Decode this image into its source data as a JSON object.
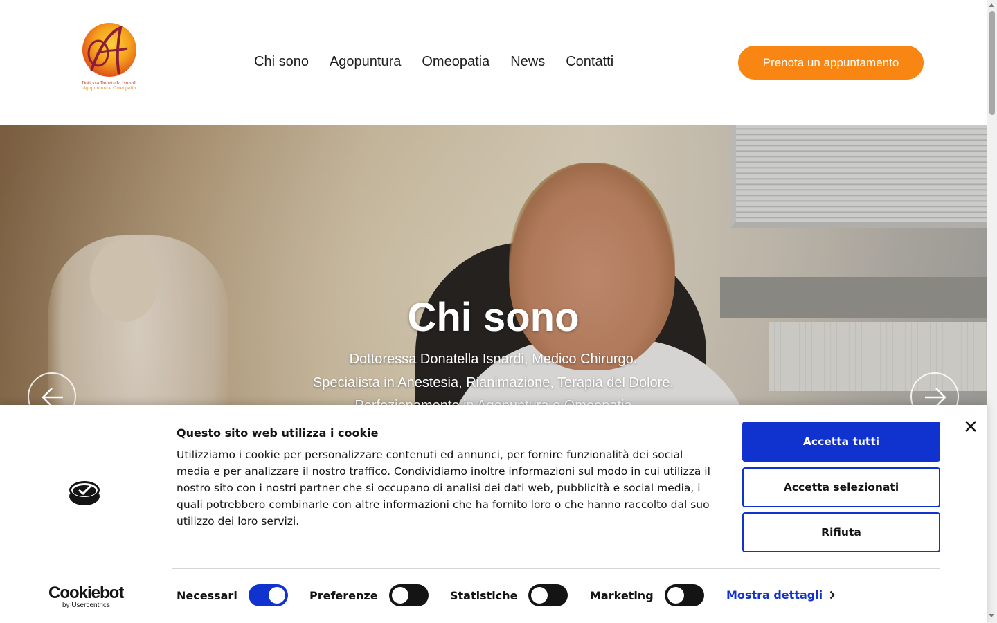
{
  "header": {
    "logo_caption_line1": "Dott.ssa Donatella Isnardi",
    "logo_caption_line2": "Agopuntura e Omeopatia",
    "nav": [
      "Chi sono",
      "Agopuntura",
      "Omeopatia",
      "News",
      "Contatti"
    ],
    "cta_label": "Prenota un appuntamento"
  },
  "hero": {
    "title": "Chi sono",
    "lines": [
      "Dottoressa Donatella Isnardi, Medico Chirurgo.",
      "Specialista in Anestesia, Rianimazione, Terapia del Dolore.",
      "Perfezionamento in Agopuntura e Omeopatia"
    ]
  },
  "cookie": {
    "title": "Questo sito web utilizza i cookie",
    "text": "Utilizziamo i cookie per personalizzare contenuti ed annunci, per fornire funzionalità dei social media e per analizzare il nostro traffico. Condividiamo inoltre informazioni sul modo in cui utilizza il nostro sito con i nostri partner che si occupano di analisi dei dati web, pubblicità e social media, i quali potrebbero combinarle con altre informazioni che ha fornito loro o che hanno raccolto dal suo utilizzo dei loro servizi.",
    "buttons": {
      "accept_all": "Accetta tutti",
      "accept_selected": "Accetta selezionati",
      "reject": "Rifiuta"
    },
    "brand_name": "Cookiebot",
    "brand_sub": "by Usercentrics",
    "toggles": [
      {
        "label": "Necessari",
        "on": true
      },
      {
        "label": "Preferenze",
        "on": false
      },
      {
        "label": "Statistiche",
        "on": false
      },
      {
        "label": "Marketing",
        "on": false
      }
    ],
    "details_label": "Mostra dettagli"
  },
  "colors": {
    "accent_orange": "#f98512",
    "cookie_blue": "#1032cf"
  }
}
